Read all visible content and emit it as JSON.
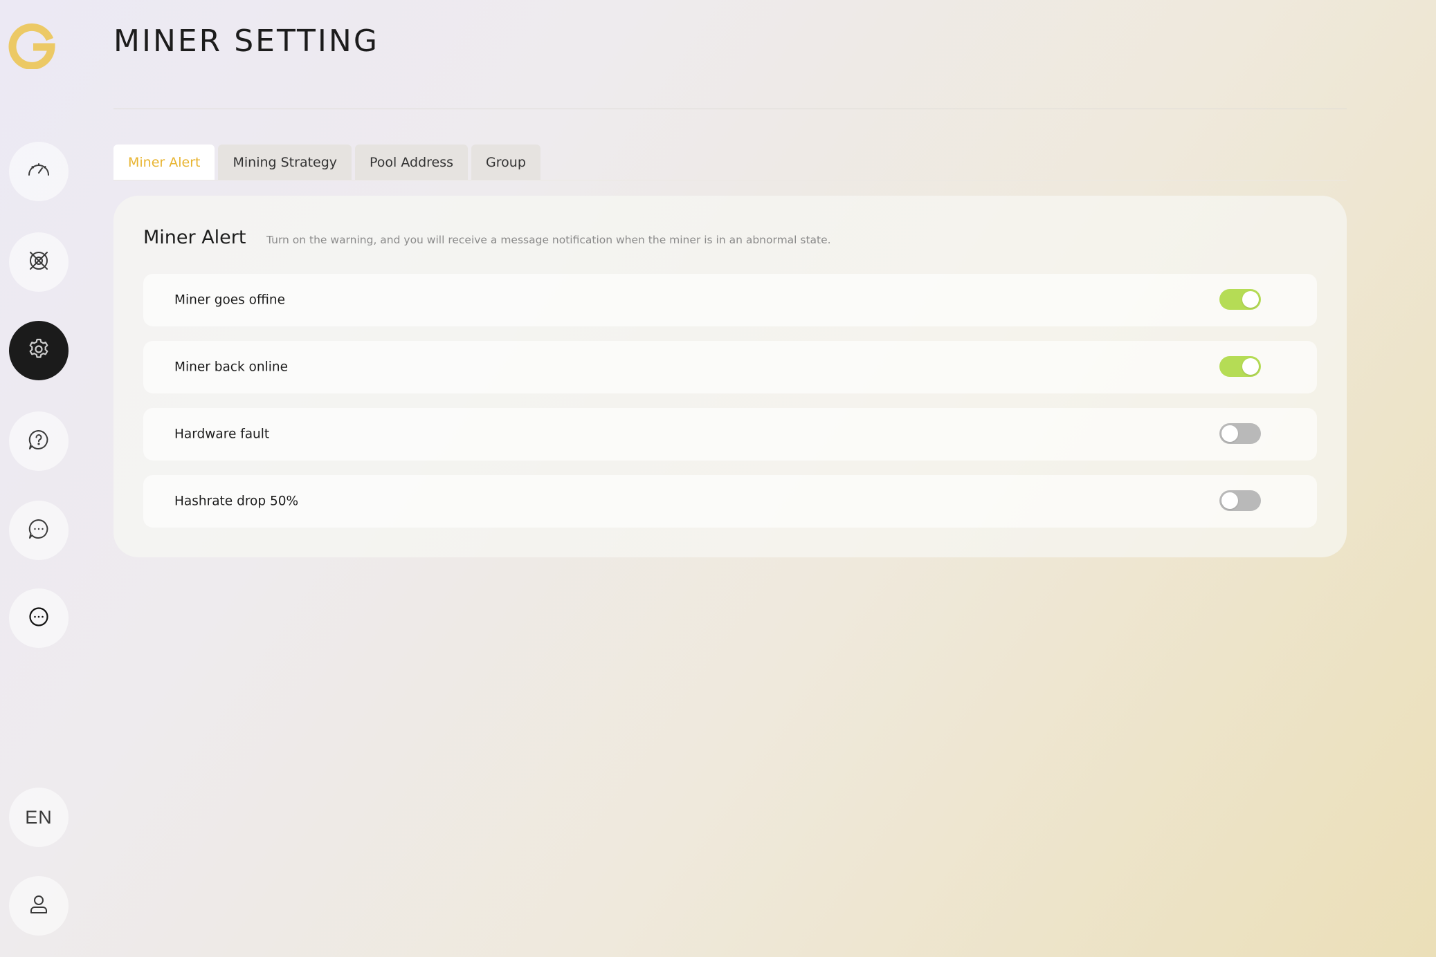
{
  "header": {
    "title": "MINER SETTING"
  },
  "sidebar": {
    "logo_icon": "g-logo",
    "items": [
      {
        "icon": "speedometer-icon"
      },
      {
        "icon": "mining-icon"
      },
      {
        "icon": "gear-icon",
        "active": true
      },
      {
        "icon": "help-icon"
      },
      {
        "icon": "chat-icon"
      },
      {
        "icon": "more-icon"
      }
    ],
    "language": "EN",
    "user_icon": "user-icon"
  },
  "tabs": [
    {
      "label": "Miner Alert",
      "active": true
    },
    {
      "label": "Mining Strategy",
      "active": false
    },
    {
      "label": "Pool Address",
      "active": false
    },
    {
      "label": "Group",
      "active": false
    }
  ],
  "card": {
    "title": "Miner Alert",
    "description": "Turn on the warning, and you will receive a message notification when the miner is in an abnormal state.",
    "alerts": [
      {
        "label": "Miner goes offine",
        "enabled": true
      },
      {
        "label": "Miner back online",
        "enabled": true
      },
      {
        "label": "Hardware fault",
        "enabled": false
      },
      {
        "label": "Hashrate drop 50%",
        "enabled": false
      }
    ]
  },
  "colors": {
    "accent": "#e8b430",
    "logo": "#ecc965",
    "toggle_on": "#b5dc55",
    "toggle_off": "#b9b9b9",
    "nav_active": "#1b1b1b"
  }
}
